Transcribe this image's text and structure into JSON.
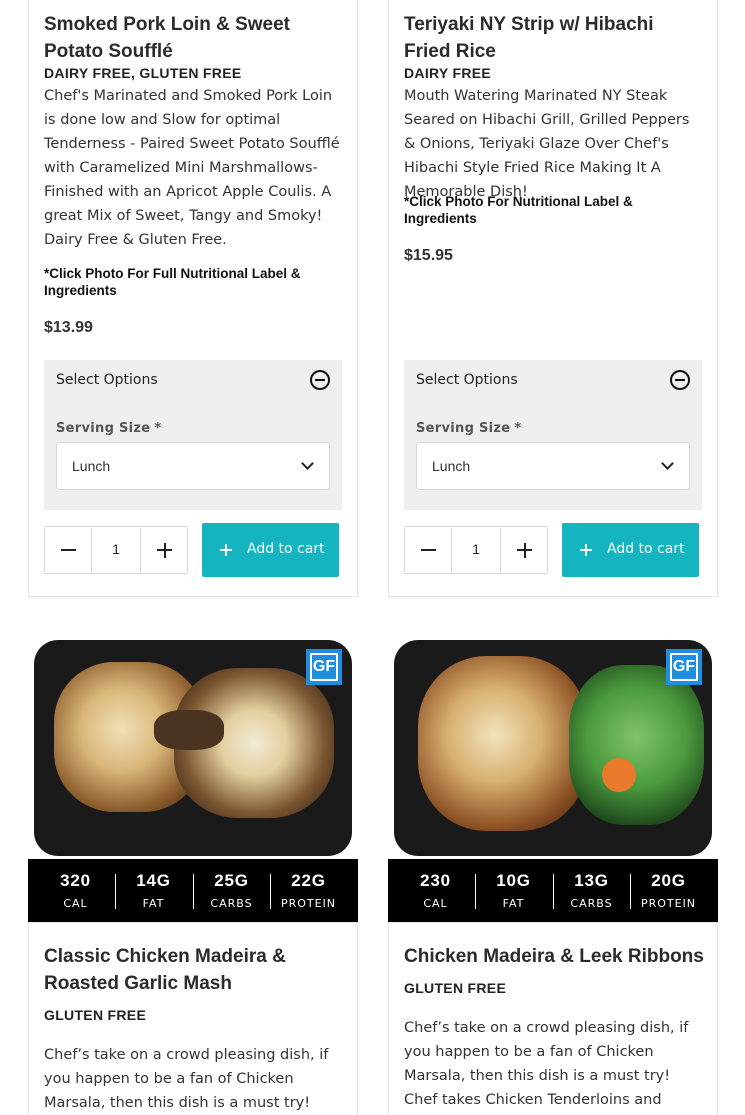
{
  "products": [
    {
      "title": "Smoked Pork Loin & Sweet Potato Soufflé",
      "diet": "DAIRY FREE, GLUTEN FREE",
      "description": "Chef's Marinated and Smoked Pork Loin is done low and Slow for optimal Tenderness - Paired Sweet Potato Soufflé with Caramelized Mini Marshmallows- Finished with an Apricot Apple Coulis.  A great Mix of Sweet, Tangy and Smoky! Dairy Free & Gluten Free.",
      "note": "*Click Photo For Full Nutritional Label & Ingredients",
      "price": "$13.99",
      "options_label": "Select Options",
      "serving_label": "Serving Size",
      "required_mark": "*",
      "serving_value": "Lunch",
      "quantity": "1",
      "cart_label": "Add to cart"
    },
    {
      "title": "Teriyaki NY Strip w/ Hibachi Fried Rice",
      "diet": "DAIRY FREE",
      "description": "Mouth Watering Marinated NY Steak Seared on Hibachi Grill, Grilled Peppers & Onions, Teriyaki Glaze Over Chef's Hibachi Style Fried Rice Making It A Memorable Dish!",
      "note": "*Click Photo For Nutritional Label & Ingredients",
      "price": "$15.95",
      "options_label": "Select Options",
      "serving_label": "Serving Size",
      "required_mark": "*",
      "serving_value": "Lunch",
      "quantity": "1",
      "cart_label": "Add to cart"
    },
    {
      "badge": "GF",
      "macros": [
        {
          "value": "320",
          "label": "CAL"
        },
        {
          "value": "14G",
          "label": "FAT"
        },
        {
          "value": "25G",
          "label": "CARBS"
        },
        {
          "value": "22G",
          "label": "PROTEIN"
        }
      ],
      "title": "Classic Chicken Madeira & Roasted Garlic Mash",
      "diet": "GLUTEN FREE",
      "description": "Chef’s take on a crowd pleasing dish, if you happen to be a fan of Chicken Marsala, then this dish is a must try! Chef takes"
    },
    {
      "badge": "GF",
      "macros": [
        {
          "value": "230",
          "label": "CAL"
        },
        {
          "value": "10G",
          "label": "FAT"
        },
        {
          "value": "13G",
          "label": "CARBS"
        },
        {
          "value": "20G",
          "label": "PROTEIN"
        }
      ],
      "title": "Chicken Madeira & Leek Ribbons",
      "diet": "GLUTEN FREE",
      "description": "Chef’s take on a crowd pleasing dish, if you happen to be a fan of Chicken Marsala, then this dish is a must try! Chef takes Chicken Tenderloins and pounds them thin,"
    }
  ],
  "colors": {
    "accent": "#14b5c0",
    "badge": "#1e8fe0",
    "macro_bar": "#000000",
    "options_bg": "#efefef"
  }
}
